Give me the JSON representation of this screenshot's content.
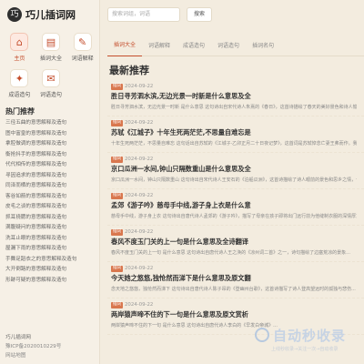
{
  "brand": {
    "logo_glyph": "巧",
    "name": "巧儿插词网"
  },
  "search": {
    "placeholder": "搜索词组，词语",
    "button": "搜索"
  },
  "nav": [
    {
      "label": "主页",
      "icon": "home-icon",
      "glyph": "⌂",
      "active": true
    },
    {
      "label": "插词大全",
      "icon": "book-icon",
      "glyph": "▤",
      "active": false
    },
    {
      "label": "词语解释",
      "icon": "dictionary-icon",
      "glyph": "✎",
      "active": false
    },
    {
      "label": "成语造句",
      "icon": "idiom-icon",
      "glyph": "✦",
      "active": false
    },
    {
      "label": "词语造句",
      "icon": "sentence-icon",
      "glyph": "✉",
      "active": false
    }
  ],
  "hot": {
    "title": "热门推荐",
    "items": [
      "三径五曲的意思解释及造句",
      "图中富皇的意思解释及造句",
      "拿腔做调的意思解释及造句",
      "衡抢抖手的意思解释及造句",
      "代代相传的意思解释及造句",
      "寻因追求的意思解释及造句",
      "同泽而栖的意思解释及造句",
      "客谷如箭的意思解释及造句",
      "皮毛之谈的意思解释及造句",
      "抓耳挠腮的意思解释及造句",
      "满腹疑问的意思解释及造句",
      "洗耳止眼的意思解释及造句",
      "屋漏下雨的意思解释及造句",
      "手舞足蹈衣之的意思解释及造句",
      "大开倒路的意思解释及造句",
      "形跡可疑的意思解释及造句"
    ]
  },
  "footer": {
    "title": "巧儿插词网",
    "icp": "豫ICP备2020010229号",
    "map": "网站地图"
  },
  "tabs": [
    "插词大全",
    "词语解释",
    "成语造句",
    "词语造句",
    "插词名句"
  ],
  "section_title": "最新推荐",
  "articles": [
    {
      "tag": "插词",
      "date": "2024-09-22",
      "title": "胜日寻芳泗水滨,无边光景一时新是什么意思及全",
      "summary": "胜日寻芳泗水滨，无边光景一时新 是什么意思  这句诗出自宋代诗人朱熹的《春日》，这首诗描绘了春天的美好景色和诗人愉悦的心情。..."
    },
    {
      "tag": "插词",
      "date": "2024-09-22",
      "title": "苏轼《江城子》十年生死两茫茫,不思量自难忘是",
      "summary": "十年生死两茫茫，不思量自难忘  这句话出自苏轼的《江城子·乙卯正月二十日夜记梦》，这首词是苏轼悼念亡妻王弗而作。我们来..."
    },
    {
      "tag": "插词",
      "date": "2024-09-22",
      "title": "京口瓜洲一水间,钟山只隔数重山是什么意思及全",
      "summary": "京口瓜洲一水间，钟山只隔数重山  这句诗出自宋代诗人王安石的《泊船瓜洲》，这首诗描绘了诗人眼前的景色和思乡之情，一幅幅..."
    },
    {
      "tag": "插词",
      "date": "2024-09-22",
      "title": "孟郊《游子吟》慈母手中线,游子身上衣是什么意",
      "summary": "慈母手中线，游子身上衣  这句诗出自唐代诗人孟郊的《游子吟》，描写了母亲在孩子即将出门远行前为他缝制衣服的深情厚意，..."
    },
    {
      "tag": "插词",
      "date": "2024-09-22",
      "title": "春风不度玉门关的上一句是什么意思及全诗翻译",
      "summary": "春风不度玉门关的上一句 是什么意思  这句诗出自唐代诗人王之涣的《凉州词二首》之一，诗句描绘了边塞荒凉的景象..."
    },
    {
      "tag": "插词",
      "date": "2024-09-22",
      "title": "今天她之悠悠,独怆然而涕下是什么意思及原文翻",
      "summary": "念天地之悠悠，独怆然而涕下  这句诗出自唐代诗人陈子昂的《登幽州台歌》，这首诗描写了诗人登高望远时的孤独与悲伤..."
    },
    {
      "tag": "插词",
      "date": "2024-09-22",
      "title": "两岸猿声啼不住的下一句是什么意思及原文赏析",
      "summary": "两岸猿声啼不住的下一句 是什么意思  这句诗出自唐代诗人李白的《早发白帝城》..."
    }
  ],
  "watermark": {
    "name": "自动秒收录",
    "sub": "上线秒收录→关注一次→自动收录"
  },
  "colors": {
    "accent": "#c44d2c",
    "background": "#f3ecdf",
    "tag": "#d9774e"
  }
}
